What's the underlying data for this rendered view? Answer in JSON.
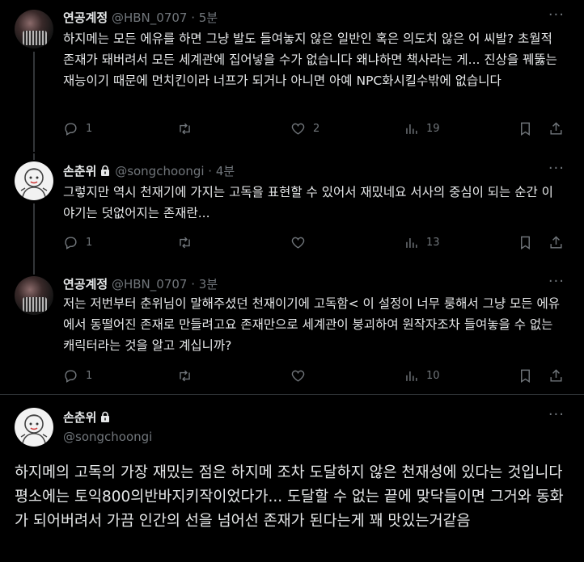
{
  "replies": [
    {
      "display_name": "연공계정",
      "handle": "@HBN_0707",
      "separator": "·",
      "time": "5분",
      "protected": false,
      "text": "하지메는 모든 에유를 하면 그냥 발도  들여놓지 않은 일반인 혹은 의도치 않은 어 씨발? 초월적 존재가 돼버려서 모든 세계관에 집어넣을 수가 없습니다 왜냐하면 책사라는 게... 진상을 꿰뚫는 재능이기 때문에 먼치킨이라 너프가 되거나 아니면 아예 NPC화시킬수밖에 없습니다",
      "reply_count": "1",
      "retweet_count": "",
      "like_count": "2",
      "view_count": "19"
    },
    {
      "display_name": "손춘위",
      "handle": "@songchoongi",
      "separator": "·",
      "time": "4분",
      "protected": true,
      "text": "그렇지만 역시 천재기에 가지는 고독을 표현할 수 있어서 재밌네요 서사의 중심이 되는 순간 이야기는 덧없어지는 존재란...",
      "reply_count": "1",
      "retweet_count": "",
      "like_count": "",
      "view_count": "13"
    },
    {
      "display_name": "연공계정",
      "handle": "@HBN_0707",
      "separator": "·",
      "time": "3분",
      "protected": false,
      "text": "저는 저번부터 춘위님이 말해주셨던 천재이기에 고독함< 이 설정이 너무 룽해서 그냥 모든 에유에서 동떨어진 존재로 만들려고요 존재만으로 세계관이 붕괴하여 원작자조차 들여놓을 수 없는 캐릭터라는 것을 알고 계십니까?",
      "reply_count": "1",
      "retweet_count": "",
      "like_count": "",
      "view_count": "10"
    }
  ],
  "main_tweet": {
    "display_name": "손춘위",
    "handle": "@songchoongi",
    "protected": true,
    "text": "하지메의 고독의 가장 재밌는 점은 하지메 조차 도달하지 않은 천재성에 있다는 것입니다 평소에는 토익800의반바지키작이었다가... 도달할 수 없는 끝에 맞닥들이면 그거와 동화가 되어버려서 가끔 인간의 선을 넘어선 존재가 된다는게 꽤 맛있는거같음"
  },
  "icons": {
    "more": "more-horizontal-icon",
    "reply": "reply-icon",
    "retweet": "retweet-icon",
    "like": "heart-icon",
    "views": "views-icon",
    "bookmark": "bookmark-icon",
    "share": "share-icon",
    "lock": "lock-icon"
  },
  "colors": {
    "background": "#000000",
    "text": "#e7e9ea",
    "muted": "#71767b",
    "divider": "#2f3336"
  }
}
